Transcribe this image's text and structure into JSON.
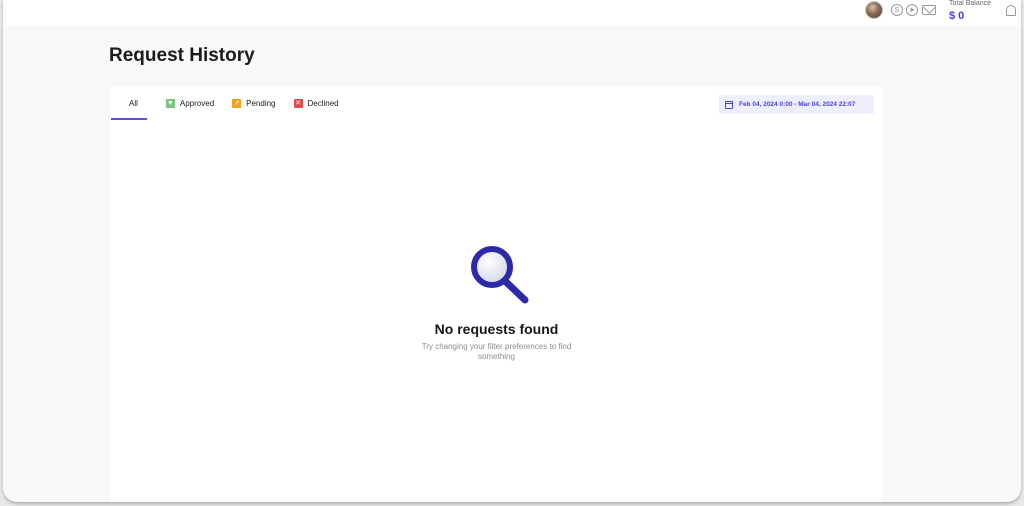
{
  "page": {
    "title": "Request History"
  },
  "header": {
    "total_balance_label": "Total Balance",
    "total_balance_value": "$ 0"
  },
  "tabs": [
    {
      "label": "All",
      "active": true
    },
    {
      "label": "Approved",
      "icon": "check-icon",
      "color": "#7bc47f"
    },
    {
      "label": "Pending",
      "icon": "pending-icon",
      "color": "#f0a21c"
    },
    {
      "label": "Declined",
      "icon": "close-icon",
      "color": "#e14b4b"
    }
  ],
  "filter": {
    "date_range": "Feb 04, 2024 0:00 - Mar 04, 2024 22:07"
  },
  "empty_state": {
    "title": "No requests found",
    "subtitle": "Try changing your filter preferences to find something"
  },
  "colors": {
    "accent": "#4b3fe0",
    "magnifier": "#2d2aa8"
  }
}
